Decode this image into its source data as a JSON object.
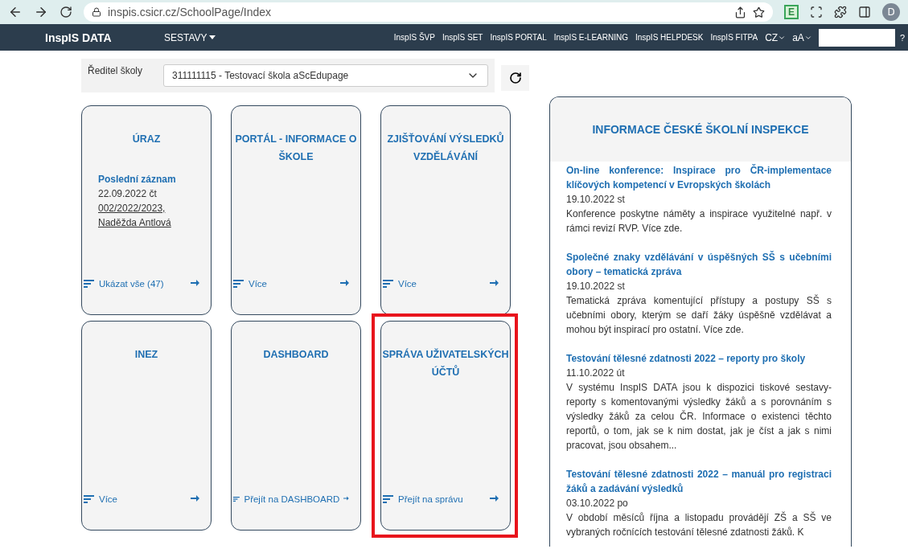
{
  "browser": {
    "url": "inspis.csicr.cz/SchoolPage/Index",
    "extension_label": "E",
    "avatar": "D"
  },
  "navbar": {
    "brand": "InspIS DATA",
    "menu": {
      "label": "SESTAVY"
    },
    "links": [
      "InspIS ŠVP",
      "InspIS SET",
      "InspIS PORTAL",
      "InspIS E-LEARNING",
      "InspIS HELPDESK",
      "InspIS FITPA"
    ],
    "language": "CZ",
    "font_size": "aA",
    "help": "?"
  },
  "school_selector": {
    "label": "Ředitel školy",
    "value": "311111115 - Testovací škola aScEdupage"
  },
  "tiles": [
    {
      "title": "ÚRAZ",
      "highlighted": false,
      "record": {
        "heading": "Poslední záznam",
        "date": "22.09.2022 čt",
        "links": [
          "002/2022/2023,",
          "Naděžda Antlová"
        ]
      },
      "link": "Ukázat vše (47)"
    },
    {
      "title": "PORTÁL - INFORMACE O ŠKOLE",
      "highlighted": false,
      "link": "Více"
    },
    {
      "title": "ZJIŠŤOVÁNÍ VÝSLEDKŮ VZDĚLÁVÁNÍ",
      "highlighted": false,
      "link": "Více"
    },
    {
      "title": "INEZ",
      "highlighted": false,
      "link": "Více"
    },
    {
      "title": "DASHBOARD",
      "highlighted": false,
      "link": "Přejít na DASHBOARD"
    },
    {
      "title": "SPRÁVA UŽIVATELSKÝCH ÚČTŮ",
      "highlighted": true,
      "link": "Přejít na správu"
    }
  ],
  "news": {
    "title": "INFORMACE ČESKÉ ŠKOLNÍ INSPEKCE",
    "items": [
      {
        "title": "On-line konference: Inspirace pro ČR-implementace klíčových kompetencí v Evropských školách",
        "date": "19.10.2022 st",
        "text": "Konference poskytne náměty a inspirace využitelné např. v rámci revizí RVP. Více zde."
      },
      {
        "title": "Společné znaky vzdělávání v úspěšných SŠ s učebními obory – tematická zpráva",
        "date": "19.10.2022 st",
        "text": "Tematická zpráva komentující přístupy a postupy SŠ s učebními obory, kterým se daří žáky úspěšně vzdělávat a mohou být inspirací pro ostatní. Více zde."
      },
      {
        "title": "Testování tělesné zdatnosti 2022 – reporty pro školy",
        "date": "11.10.2022 út",
        "text": "V systému InspIS DATA jsou k dispozici tiskové sestavy-reporty s komentovanými výsledky žáků a s porovnáním s výsledky žáků za celou ČR. Informace o existenci těchto reportů, o tom, jak se k nim dostat, jak je číst a jak s nimi pracovat, jsou obsahem..."
      },
      {
        "title": "Testování tělesné zdatnosti 2022 – manuál pro registraci žáků a zadávání výsledků",
        "date": "03.10.2022 po",
        "text": "V období měsíců října a listopadu provádějí ZŠ a SŠ ve vybraných ročnících testování tělesné zdatnosti žáků. K"
      }
    ]
  }
}
